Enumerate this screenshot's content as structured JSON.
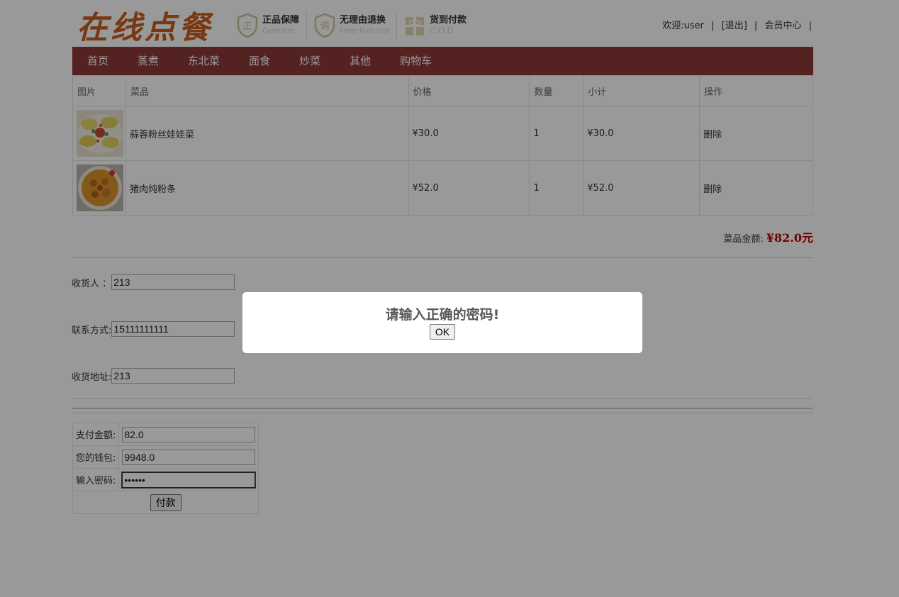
{
  "header": {
    "logo_text": "在线点餐",
    "badges": [
      {
        "icon": "shield-genuine-icon",
        "glyph": "正",
        "title": "正品保障",
        "sub": "Genuine"
      },
      {
        "icon": "shield-return-icon",
        "glyph": "调",
        "title": "无理由退换",
        "sub": "Free Returns"
      },
      {
        "icon": "gift-cod-icon",
        "glyph": "",
        "title": "货到付款",
        "sub": "C.O.D"
      }
    ],
    "welcome": "欢迎:user",
    "sep": "|",
    "logout": "[退出]",
    "member_center": "会员中心"
  },
  "nav": [
    "首页",
    "蒸煮",
    "东北菜",
    "面食",
    "炒菜",
    "其他",
    "购物车"
  ],
  "cart": {
    "columns": [
      "图片",
      "菜品",
      "价格",
      "数量",
      "小计",
      "操作"
    ],
    "rows": [
      {
        "name": "蒜蓉粉丝娃娃菜",
        "price": "¥30.0",
        "qty": "1",
        "subtotal": "¥30.0",
        "action": "删除"
      },
      {
        "name": "猪肉炖粉条",
        "price": "¥52.0",
        "qty": "1",
        "subtotal": "¥52.0",
        "action": "删除"
      }
    ],
    "total_label": "菜品金额:",
    "total_value": "¥82.0元"
  },
  "shipping": {
    "receiver_label": "收货人 ：",
    "receiver_value": "213",
    "contact_label": "联系方式:",
    "contact_value": "15111111111",
    "address_label": "收货地址:",
    "address_value": "213"
  },
  "payment": {
    "amount_label": "支付金额:",
    "amount_value": "82.0",
    "wallet_label": "您的钱包:",
    "wallet_value": "9948.0",
    "password_label": "输入密码:",
    "password_value": "123456",
    "pay_button": "付款"
  },
  "dialog": {
    "message": "请输入正确的密码!",
    "ok_button": "OK"
  },
  "colors": {
    "nav_bg": "#8e3a3a",
    "logo": "#c9601f",
    "total_amount": "#c00000"
  }
}
